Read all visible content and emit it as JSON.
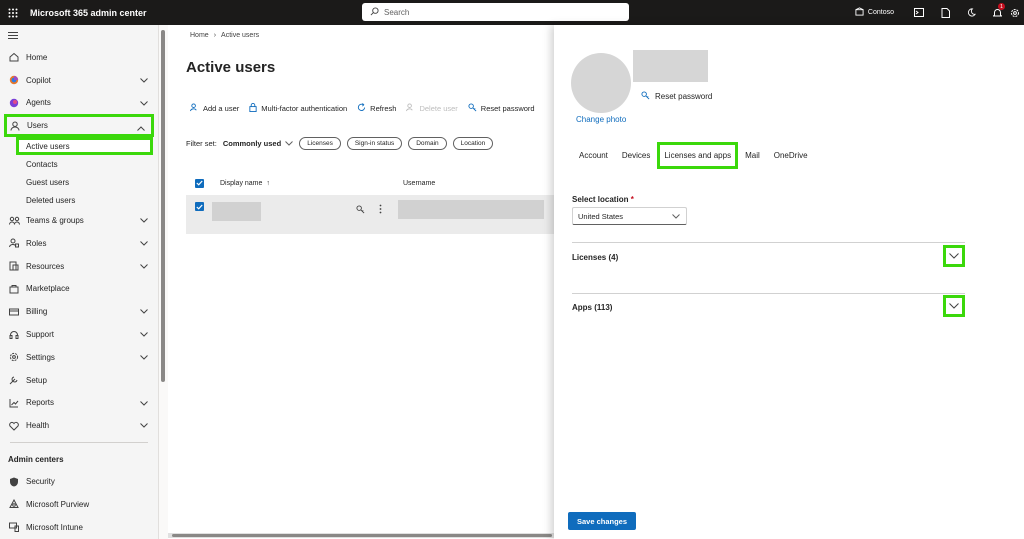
{
  "topbar": {
    "app_title": "Microsoft 365 admin center",
    "search_placeholder": "Search",
    "tenant_name": "Contoso",
    "notification_count": "1"
  },
  "nav": {
    "items": [
      {
        "label": "Home",
        "icon": "home-icon",
        "chevron": false
      },
      {
        "label": "Copilot",
        "icon": "copilot-icon",
        "chevron": true
      },
      {
        "label": "Agents",
        "icon": "agents-icon",
        "chevron": true
      },
      {
        "label": "Users",
        "icon": "person-icon",
        "chevron": "up"
      }
    ],
    "users_sub": [
      "Active users",
      "Contacts",
      "Guest users",
      "Deleted users"
    ],
    "items2": [
      {
        "label": "Teams & groups",
        "icon": "teams-icon"
      },
      {
        "label": "Roles",
        "icon": "roles-icon"
      },
      {
        "label": "Resources",
        "icon": "resources-icon"
      },
      {
        "label": "Marketplace",
        "icon": "marketplace-icon"
      },
      {
        "label": "Billing",
        "icon": "billing-icon"
      },
      {
        "label": "Support",
        "icon": "support-icon"
      },
      {
        "label": "Settings",
        "icon": "gear-icon"
      },
      {
        "label": "Setup",
        "icon": "setup-icon"
      },
      {
        "label": "Reports",
        "icon": "reports-icon"
      },
      {
        "label": "Health",
        "icon": "health-icon"
      }
    ],
    "admin_centers_title": "Admin centers",
    "admin_centers": [
      "Security",
      "Microsoft Purview",
      "Microsoft Intune"
    ]
  },
  "main": {
    "breadcrumb": [
      "Home",
      "Active users"
    ],
    "title": "Active users",
    "commands": [
      "Add a user",
      "Multi-factor authentication",
      "Refresh",
      "Delete user",
      "Reset password"
    ],
    "filter_label": "Filter set:",
    "filter_value": "Commonly used",
    "filter_pills": [
      "Licenses",
      "Sign-in status",
      "Domain",
      "Location"
    ],
    "columns": [
      "Display name",
      "Username"
    ]
  },
  "panel": {
    "reset_password": "Reset password",
    "change_photo": "Change photo",
    "tabs": [
      "Account",
      "Devices",
      "Licenses and apps",
      "Mail",
      "OneDrive"
    ],
    "selected_tab": "Licenses and apps",
    "location_label": "Select location",
    "location_value": "United States",
    "licenses_title": "Licenses (4)",
    "apps_title": "Apps (113)",
    "save_label": "Save changes"
  },
  "colors": {
    "accent": "#0f6cbd",
    "highlight": "#3bd80b",
    "topbar": "#1b1a19"
  }
}
